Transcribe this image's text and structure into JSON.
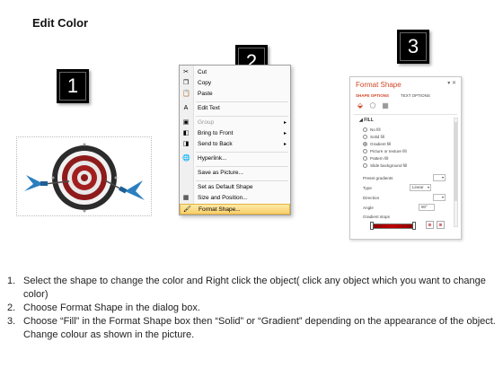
{
  "page_title": "Edit Color",
  "badges": [
    "1",
    "2",
    "3"
  ],
  "context_menu": {
    "items": [
      {
        "label": "Cut",
        "icon": "scissors-icon",
        "glyph": "✂",
        "arrow": false,
        "disabled": false
      },
      {
        "label": "Copy",
        "icon": "copy-icon",
        "glyph": "❐",
        "arrow": false,
        "disabled": false
      },
      {
        "label": "Paste",
        "icon": "paste-icon",
        "glyph": "📋",
        "arrow": false,
        "disabled": false
      },
      {
        "label": "Edit Text",
        "icon": "edit-text-icon",
        "glyph": "A",
        "arrow": false,
        "disabled": false
      },
      {
        "label": "Group",
        "icon": "group-icon",
        "glyph": "▣",
        "arrow": true,
        "disabled": true
      },
      {
        "label": "Bring to Front",
        "icon": "bring-front-icon",
        "glyph": "◧",
        "arrow": true,
        "disabled": false
      },
      {
        "label": "Send to Back",
        "icon": "send-back-icon",
        "glyph": "◨",
        "arrow": true,
        "disabled": false
      },
      {
        "label": "Hyperlink...",
        "icon": "hyperlink-icon",
        "glyph": "🌐",
        "arrow": false,
        "disabled": false
      },
      {
        "label": "Save as Picture...",
        "icon": "",
        "glyph": "",
        "arrow": false,
        "disabled": false
      },
      {
        "label": "Set as Default Shape",
        "icon": "",
        "glyph": "",
        "arrow": false,
        "disabled": false
      },
      {
        "label": "Size and Position...",
        "icon": "size-position-icon",
        "glyph": "▦",
        "arrow": false,
        "disabled": false
      },
      {
        "label": "Format Shape...",
        "icon": "format-shape-icon",
        "glyph": "🖌",
        "arrow": false,
        "disabled": false
      }
    ]
  },
  "format_pane": {
    "title": "Format Shape",
    "close": "▾ ✕",
    "tabs": [
      "SHAPE OPTIONS",
      "TEXT OPTIONS"
    ],
    "section": "FILL",
    "fill_options": [
      {
        "label": "No fill",
        "checked": false
      },
      {
        "label": "Solid fill",
        "checked": false
      },
      {
        "label": "Gradient fill",
        "checked": true
      },
      {
        "label": "Picture or texture fill",
        "checked": false
      },
      {
        "label": "Pattern fill",
        "checked": false
      },
      {
        "label": "Slide background fill",
        "checked": false
      }
    ],
    "rows": [
      {
        "label": "Preset gradients",
        "value": ""
      },
      {
        "label": "Type",
        "value": "Linear"
      },
      {
        "label": "Direction",
        "value": ""
      },
      {
        "label": "Angle",
        "value": "90°"
      }
    ],
    "gradient_stops_label": "Gradient stops",
    "colors": {
      "accent": "#d24726",
      "bar_dark": "#8b0000",
      "bar_mid": "#c00000"
    }
  },
  "instructions": [
    {
      "num": "1.",
      "text": "Select the shape to change the color and Right click the object( click any object which you want to change color)"
    },
    {
      "num": "2.",
      "text": "Choose Format Shape in the dialog box."
    },
    {
      "num": "3.",
      "text": "Choose “Fill” in the Format Shape box then “Solid” or “Gradient” depending on the appearance of the object. Change colour as shown in the picture."
    }
  ]
}
